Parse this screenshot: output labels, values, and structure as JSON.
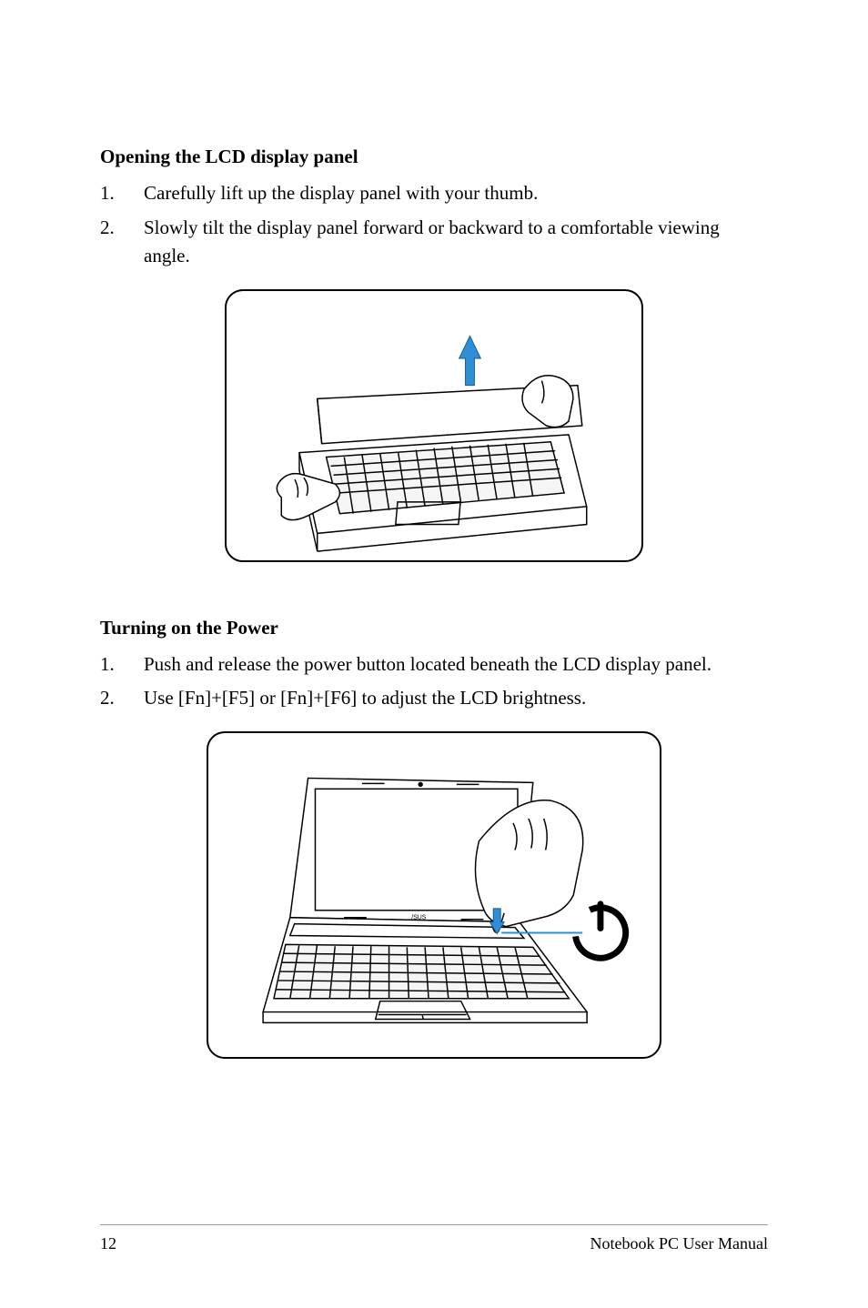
{
  "section1": {
    "heading": "Opening the LCD display panel",
    "items": [
      {
        "num": "1.",
        "text": "Carefully lift up the display panel with your thumb."
      },
      {
        "num": "2.",
        "text": "Slowly tilt the display panel forward or backward to a comfortable viewing angle."
      }
    ]
  },
  "section2": {
    "heading": "Turning on the Power",
    "items": [
      {
        "num": "1.",
        "text": "Push and release the power button located beneath the LCD display panel."
      },
      {
        "num": "2.",
        "text": "Use [Fn]+[F5] or [Fn]+[F6] to adjust the LCD brightness."
      }
    ]
  },
  "footer": {
    "page": "12",
    "title": "Notebook PC User Manual"
  }
}
